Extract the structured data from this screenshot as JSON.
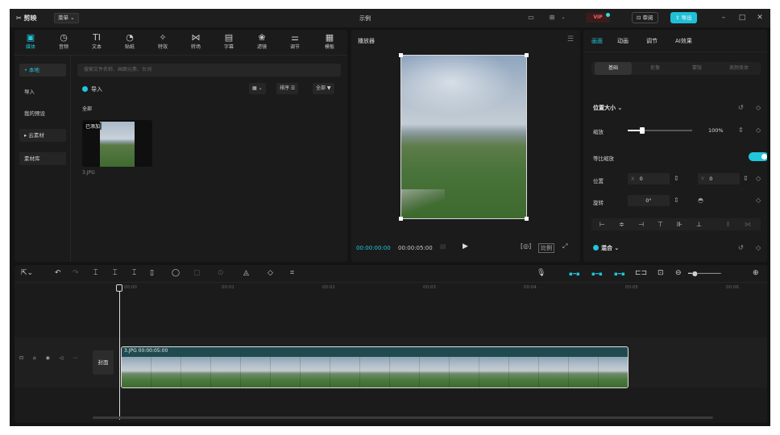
{
  "app": {
    "name": "剪映",
    "menu_label": "菜单",
    "window_title": "示例"
  },
  "titlebar": {
    "vip": "VIP",
    "review": "审阅",
    "export": "导出"
  },
  "toolbar": [
    {
      "label": "媒体",
      "icon": "media-icon",
      "glyph": "▣"
    },
    {
      "label": "音频",
      "icon": "audio-icon",
      "glyph": "◷"
    },
    {
      "label": "文本",
      "icon": "text-icon",
      "glyph": "TI"
    },
    {
      "label": "贴纸",
      "icon": "sticker-icon",
      "glyph": "◔"
    },
    {
      "label": "特效",
      "icon": "effects-icon",
      "glyph": "✧"
    },
    {
      "label": "转场",
      "icon": "transition-icon",
      "glyph": "⋈"
    },
    {
      "label": "字幕",
      "icon": "subtitle-icon",
      "glyph": "▤"
    },
    {
      "label": "滤镜",
      "icon": "filter-icon",
      "glyph": "❀"
    },
    {
      "label": "调节",
      "icon": "adjust-icon",
      "glyph": "⚌"
    },
    {
      "label": "模板",
      "icon": "template-icon",
      "glyph": "▦"
    }
  ],
  "sidebar": [
    {
      "label": "• 本地"
    },
    {
      "label": "导入"
    },
    {
      "label": "我的预设"
    },
    {
      "label": "▸ 云素材"
    },
    {
      "label": "素材库"
    }
  ],
  "media": {
    "search_placeholder": "搜索文件名称、画面元素、台词",
    "import": "导入",
    "sort": "排序 ☰",
    "filter": "全部 ▼",
    "view": "▦ ⌄",
    "all": "全部",
    "thumb_badge": "已添加",
    "thumb_name": "3.JPG"
  },
  "player": {
    "title": "播放器",
    "current_time": "00:00:00:00",
    "total_time": "00:00:05:00",
    "ratio": "比例"
  },
  "props": {
    "tabs": [
      "画面",
      "动画",
      "调节",
      "AI效果"
    ],
    "subtabs": [
      "基础",
      "抠像",
      "蒙版",
      "美颜美体"
    ],
    "section_title": "位置大小",
    "scale_label": "缩放",
    "scale_value": "100%",
    "scale_fraction": 0.2,
    "uniform_label": "等比缩放",
    "position_label": "位置",
    "pos_x_label": "X",
    "pos_x": "0",
    "pos_y_label": "Y",
    "pos_y": "0",
    "rotate_label": "旋转",
    "rotate_value": "0°",
    "blend_label": "混合"
  },
  "timeline": {
    "ticks": [
      "00:00",
      "00:01",
      "00:02",
      "00:03",
      "00:04",
      "00:05",
      "00:06"
    ],
    "cover_label": "封面",
    "clip_label": "3.JPG  00:00:05:00"
  },
  "colors": {
    "accent": "#20c7dc",
    "background": "#141414",
    "panel": "#1b1b1b"
  }
}
